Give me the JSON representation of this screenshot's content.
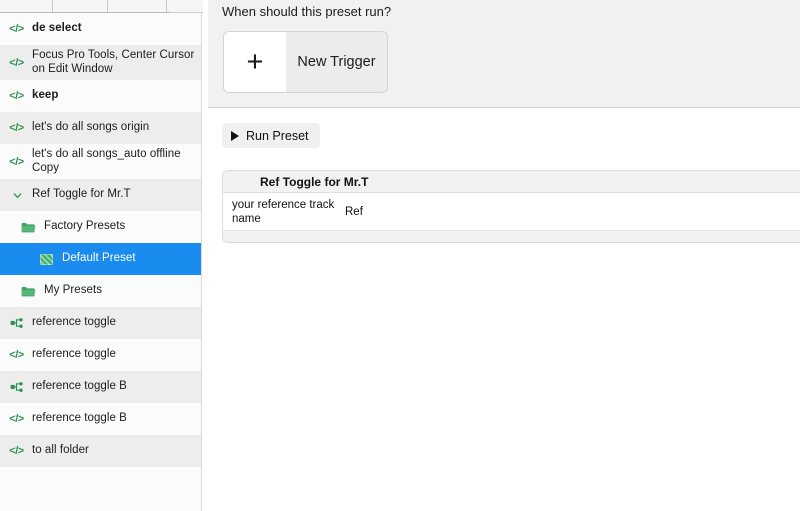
{
  "sidebar": {
    "items": [
      {
        "label": "de select",
        "icon": "code-icon",
        "indent": 0,
        "stripe": false,
        "bold": true,
        "selected": false
      },
      {
        "label": "Focus Pro Tools, Center Cursor on Edit Window",
        "icon": "code-icon",
        "indent": 0,
        "stripe": true,
        "bold": false,
        "selected": false
      },
      {
        "label": "keep",
        "icon": "code-icon",
        "indent": 0,
        "stripe": false,
        "bold": true,
        "selected": false
      },
      {
        "label": "let's do all songs origin",
        "icon": "code-icon",
        "indent": 0,
        "stripe": true,
        "bold": false,
        "selected": false
      },
      {
        "label": "let's do all songs_auto offline Copy",
        "icon": "code-icon",
        "indent": 0,
        "stripe": false,
        "bold": false,
        "selected": false
      },
      {
        "label": "Ref Toggle for Mr.T",
        "icon": "chevron-down-icon",
        "indent": 0,
        "stripe": true,
        "bold": false,
        "selected": false
      },
      {
        "label": "Factory Presets",
        "icon": "folder-icon",
        "indent": 1,
        "stripe": false,
        "bold": false,
        "selected": false
      },
      {
        "label": "Default Preset",
        "icon": "preset-icon",
        "indent": 2,
        "stripe": false,
        "bold": false,
        "selected": true
      },
      {
        "label": "My Presets",
        "icon": "folder-icon",
        "indent": 1,
        "stripe": false,
        "bold": false,
        "selected": false
      },
      {
        "label": "reference toggle",
        "icon": "branch-icon",
        "indent": 0,
        "stripe": true,
        "bold": false,
        "selected": false
      },
      {
        "label": "reference toggle",
        "icon": "code-icon",
        "indent": 0,
        "stripe": false,
        "bold": false,
        "selected": false
      },
      {
        "label": "reference toggle B",
        "icon": "branch-icon",
        "indent": 0,
        "stripe": true,
        "bold": false,
        "selected": false
      },
      {
        "label": "reference toggle B",
        "icon": "code-icon",
        "indent": 0,
        "stripe": false,
        "bold": false,
        "selected": false
      },
      {
        "label": "to all folder",
        "icon": "code-icon",
        "indent": 0,
        "stripe": true,
        "bold": false,
        "selected": false
      }
    ],
    "selected_color": "#1a8cf0",
    "icon_color": "#2e9256"
  },
  "main": {
    "trigger_section": {
      "question": "When should this preset run?",
      "new_trigger_label": "New Trigger",
      "plus_glyph": "+"
    },
    "run_section": {
      "run_preset_label": "Run Preset",
      "params_table": {
        "title": "Ref Toggle for Mr.T",
        "rows": [
          {
            "name": "your reference track name",
            "value": "Ref"
          }
        ]
      }
    }
  }
}
